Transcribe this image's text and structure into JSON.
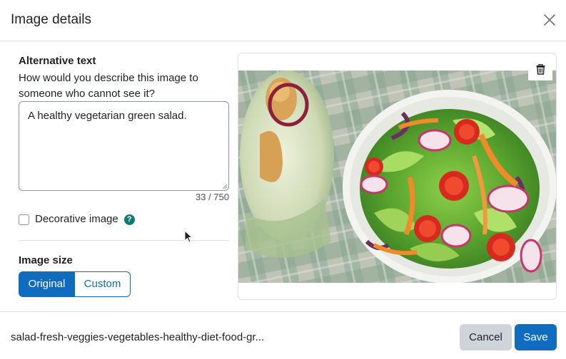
{
  "dialog": {
    "title": "Image details"
  },
  "alt_text": {
    "label": "Alternative text",
    "help": "How would you describe this image to someone who cannot see it?",
    "value": "A healthy vegetarian green salad.",
    "char_count": "33 / 750"
  },
  "decorative": {
    "label": "Decorative image",
    "checked": false,
    "help_glyph": "?"
  },
  "image_size": {
    "label": "Image size",
    "options": [
      "Original",
      "Custom"
    ],
    "selected": "Original"
  },
  "preview": {
    "delete_icon": "trash-icon"
  },
  "footer": {
    "filename": "salad-fresh-veggies-vegetables-healthy-diet-food-gr...",
    "cancel_label": "Cancel",
    "save_label": "Save"
  },
  "colors": {
    "primary": "#0f6cbf",
    "secondary_button": "#ced4da",
    "help_icon": "#0f7a75",
    "border": "#dee2e6"
  }
}
